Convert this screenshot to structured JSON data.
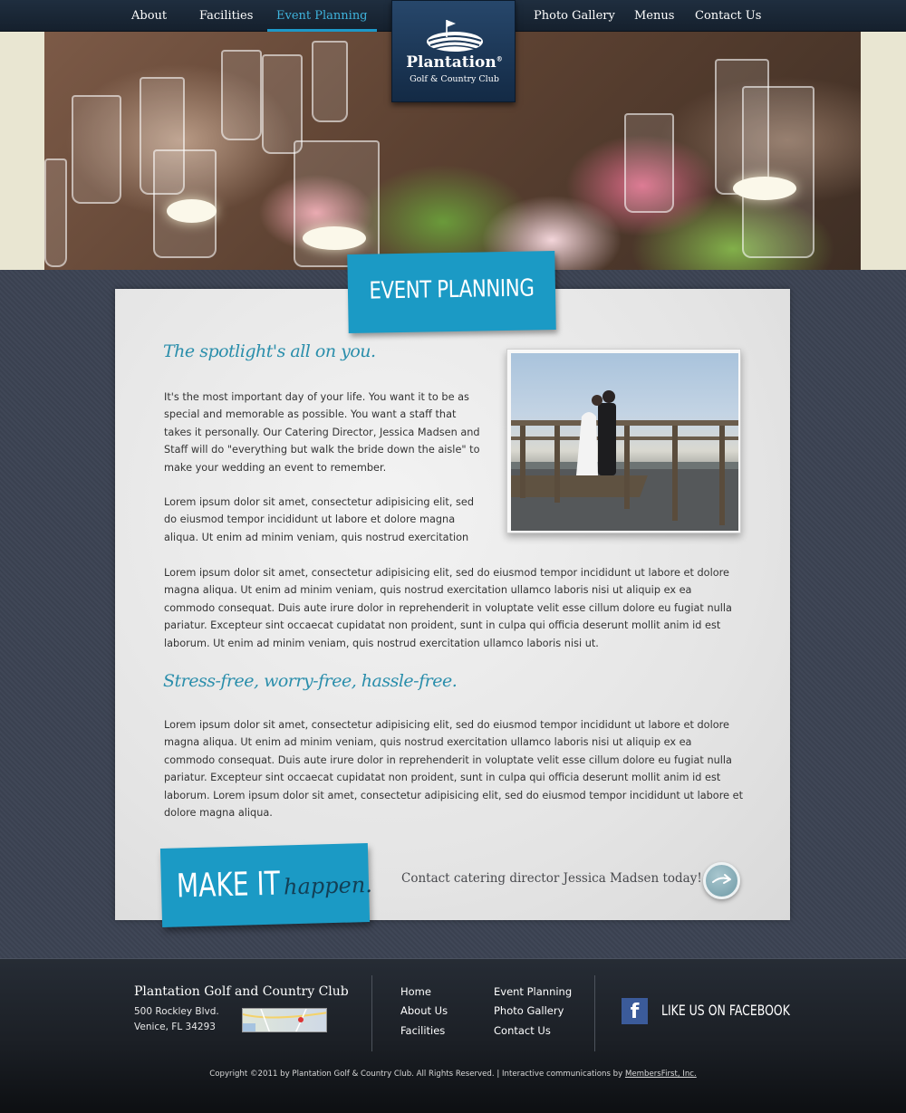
{
  "nav": {
    "items": [
      {
        "label": "About",
        "active": false
      },
      {
        "label": "Facilities",
        "active": false
      },
      {
        "label": "Event Planning",
        "active": true
      },
      {
        "label": "Photo Gallery",
        "active": false
      },
      {
        "label": "Menus",
        "active": false
      },
      {
        "label": "Contact Us",
        "active": false
      }
    ]
  },
  "logo": {
    "name": "Plantation",
    "registered": "®",
    "subtitle": "Golf & Country Club"
  },
  "page": {
    "title": "EVENT PLANNING",
    "heading1": "The spotlight's all on you.",
    "intro": "It's the most important day of your life.  You want it to be as special and memorable as possible.  You want a staff that takes it personally.  Our Catering Director, Jessica Madsen and Staff will do \"everything but walk the bride down the aisle\" to make your wedding an event to remember.",
    "para2": "Lorem ipsum dolor sit amet, consectetur adipisicing elit, sed do eiusmod tempor incididunt ut labore et dolore magna aliqua. Ut enim ad minim veniam, quis nostrud exercitation",
    "para3": "Lorem ipsum dolor sit amet, consectetur adipisicing elit, sed do eiusmod tempor incididunt ut labore et dolore magna aliqua. Ut enim ad minim veniam, quis nostrud exercitation ullamco laboris nisi ut aliquip ex ea commodo consequat. Duis aute irure dolor in reprehenderit in voluptate velit esse cillum dolore eu fugiat nulla pariatur. Excepteur sint occaecat cupidatat non proident, sunt in culpa qui officia deserunt mollit anim id est laborum. Ut enim ad minim veniam, quis nostrud exercitation ullamco laboris nisi ut.",
    "heading2": "Stress-free, worry-free, hassle-free.",
    "para4": "Lorem ipsum dolor sit amet, consectetur adipisicing elit, sed do eiusmod tempor incididunt ut labore et dolore magna aliqua. Ut enim ad minim veniam, quis nostrud exercitation ullamco laboris nisi ut aliquip ex ea commodo consequat. Duis aute irure dolor in reprehenderit in voluptate velit esse cillum dolore eu fugiat nulla pariatur. Excepteur sint occaecat cupidatat non proident, sunt in culpa qui officia deserunt mollit anim id est laborum. Lorem ipsum dolor sit amet, consectetur adipisicing elit, sed do eiusmod tempor incididunt ut labore et dolore magna aliqua."
  },
  "cta": {
    "make": "MAKE IT",
    "happen": "happen.",
    "text": "Contact catering director Jessica Madsen today!",
    "arrow_icon": "arrow-right-icon"
  },
  "footer": {
    "club_name": "Plantation Golf and Country Club",
    "address_line1": "500 Rockley Blvd.",
    "address_line2": "Venice, FL 34293",
    "links_col1": [
      "Home",
      "About Us",
      "Facilities"
    ],
    "links_col2": [
      "Event Planning",
      "Photo Gallery",
      "Contact Us"
    ],
    "facebook_icon": "f",
    "facebook_text": "LIKE US ON FACEBOOK",
    "copyright": "Copyright ©2011 by Plantation Golf & Country Club. All Rights Reserved. | Interactive communications by ",
    "credit_link": "MembersFirst, Inc."
  },
  "colors": {
    "accent": "#1b9ac5",
    "nav_bg": "#1b2735",
    "body_bg": "#3d4452",
    "heading_script": "#2a8eab"
  }
}
